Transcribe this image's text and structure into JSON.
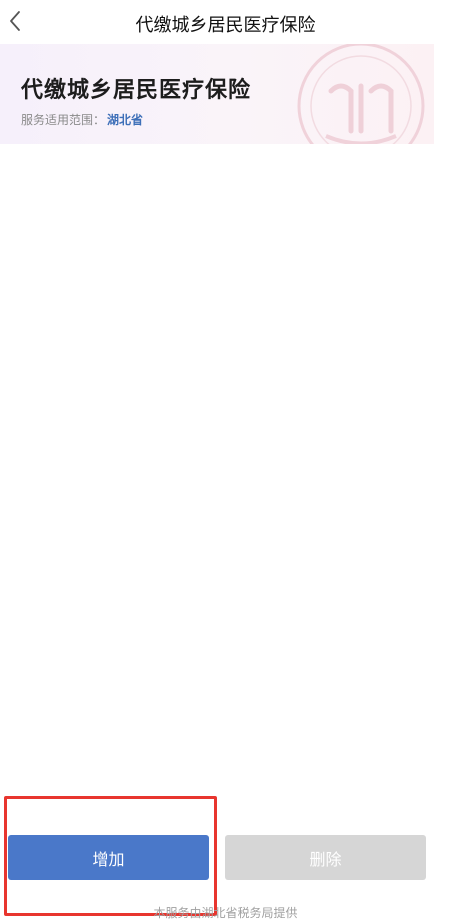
{
  "nav": {
    "title": "代缴城乡居民医疗保险",
    "back_icon": "chevron-left-icon"
  },
  "banner": {
    "title": "代缴城乡居民医疗保险",
    "scope_label": "服务适用范围：",
    "scope_value": "湖北省",
    "seal_icon": "tax-seal-watermark"
  },
  "actions": {
    "add_label": "增加",
    "delete_label": "删除"
  },
  "footer": {
    "note": "本服务由湖北省税务局提供"
  },
  "colors": {
    "primary": "#4a78c9",
    "disabled": "#d6d6d6",
    "scope_link": "#3d6fb8",
    "highlight": "#e8352e"
  }
}
